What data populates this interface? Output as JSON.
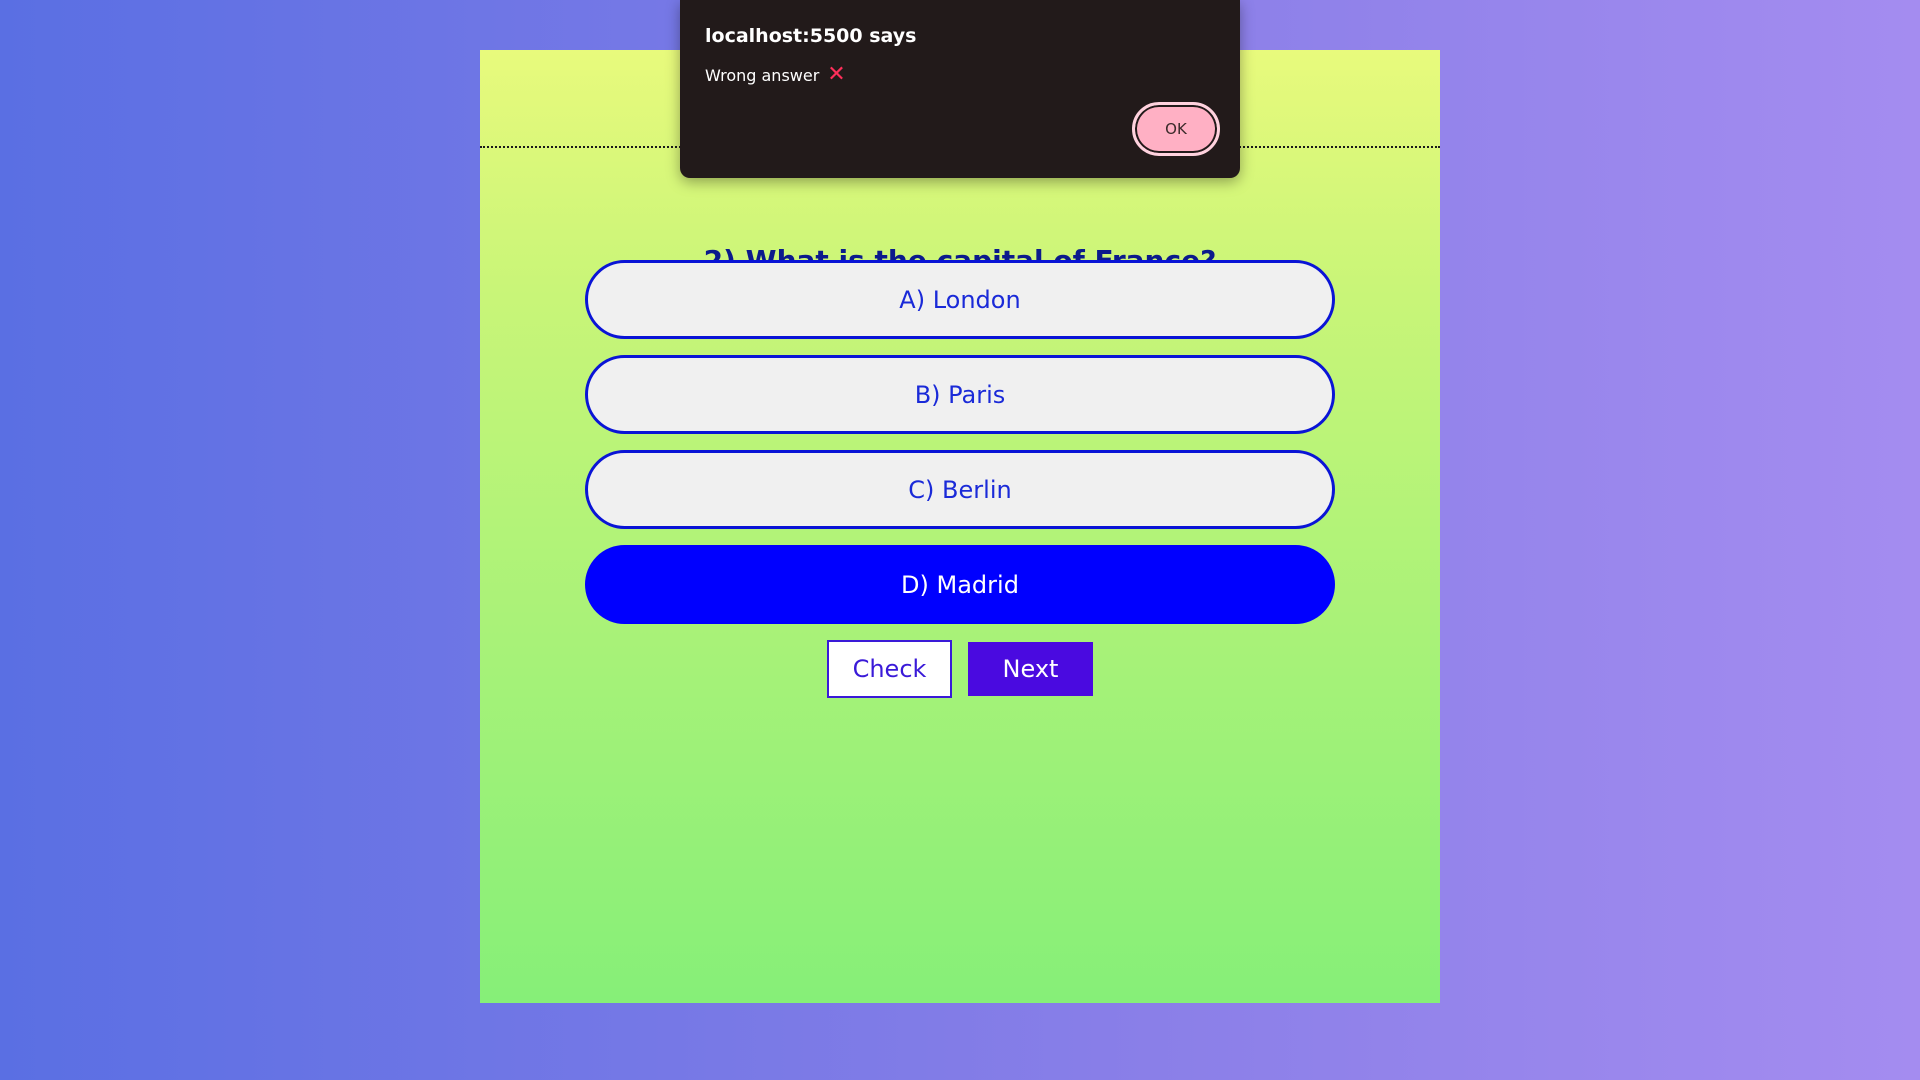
{
  "quiz": {
    "question": "2) What is the capital of France?",
    "options": [
      {
        "label": "A) London",
        "selected": false
      },
      {
        "label": "B) Paris",
        "selected": false
      },
      {
        "label": "C) Berlin",
        "selected": false
      },
      {
        "label": "D) Madrid",
        "selected": true
      }
    ],
    "check_label": "Check",
    "next_label": "Next"
  },
  "dialog": {
    "title": "localhost:5500 says",
    "message": "Wrong answer",
    "icon": "x-icon",
    "ok_label": "OK"
  },
  "colors": {
    "option_border": "#0a14d6",
    "selected_option": "#0000ff",
    "next_button": "#4a0ae0",
    "dialog_background": "#221a1a",
    "ok_button": "#ffb0c4"
  }
}
